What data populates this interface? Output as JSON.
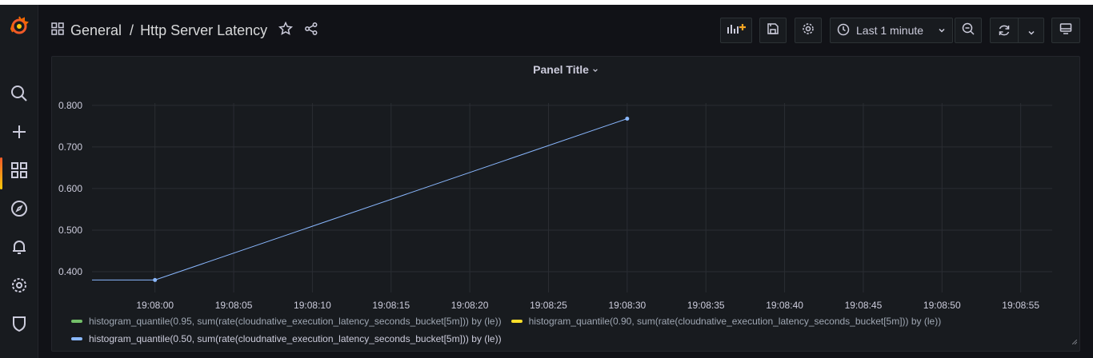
{
  "breadcrumb": {
    "folder": "General",
    "separator": "/",
    "dashboard": "Http Server Latency"
  },
  "toolbar": {
    "time_range": "Last 1 minute"
  },
  "panel": {
    "title": "Panel Title"
  },
  "icons": {
    "logo": "grafana-logo",
    "search": "search-icon",
    "create": "plus-icon",
    "dashboards": "grid-icon",
    "explore": "compass-icon",
    "alerting": "bell-icon",
    "configuration": "gear-icon",
    "admin": "shield-icon"
  },
  "colors": {
    "accent": "#f05a28",
    "series_095": "#73bf69",
    "series_090": "#fade2a",
    "series_050": "#8ab8ff"
  },
  "chart_data": {
    "type": "line",
    "title": "Panel Title",
    "x_ticks": [
      "19:08:00",
      "19:08:05",
      "19:08:10",
      "19:08:15",
      "19:08:20",
      "19:08:25",
      "19:08:30",
      "19:08:35",
      "19:08:40",
      "19:08:45",
      "19:08:50",
      "19:08:55"
    ],
    "y_ticks": [
      "0.400",
      "0.500",
      "0.600",
      "0.700",
      "0.800"
    ],
    "ylim": [
      0.35,
      0.84
    ],
    "xlim": [
      "19:07:56",
      "19:08:57"
    ],
    "grid": true,
    "legend_placement": "bottom",
    "series": [
      {
        "name": "histogram_quantile(0.95, sum(rate(cloudnative_execution_latency_seconds_bucket[5m])) by (le))",
        "color": "#73bf69",
        "points": []
      },
      {
        "name": "histogram_quantile(0.90, sum(rate(cloudnative_execution_latency_seconds_bucket[5m])) by (le))",
        "color": "#fade2a",
        "points": []
      },
      {
        "name": "histogram_quantile(0.50, sum(rate(cloudnative_execution_latency_seconds_bucket[5m])) by (le))",
        "color": "#8ab8ff",
        "points": [
          {
            "x": "19:07:56",
            "y": 0.38
          },
          {
            "x": "19:08:00",
            "y": 0.38
          },
          {
            "x": "19:08:30",
            "y": 0.768
          }
        ]
      }
    ]
  }
}
